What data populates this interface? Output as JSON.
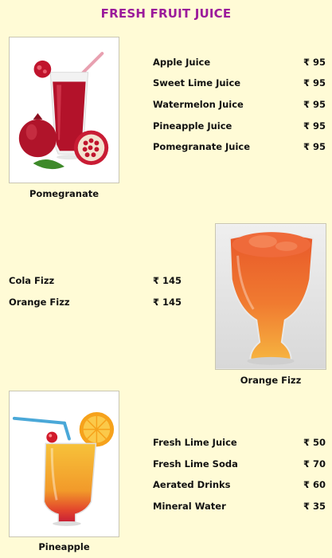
{
  "title": "FRESH FRUIT JUICE",
  "sections": [
    {
      "caption": "Pomegranate",
      "image_icon": "pomegranate-juice-photo",
      "items": [
        {
          "name": "Apple Juice",
          "price": "₹ 95"
        },
        {
          "name": "Sweet Lime Juice",
          "price": "₹ 95"
        },
        {
          "name": "Watermelon Juice",
          "price": "₹ 95"
        },
        {
          "name": "Pineapple Juice",
          "price": "₹ 95"
        },
        {
          "name": "Pomegranate Juice",
          "price": "₹ 95"
        }
      ]
    },
    {
      "caption": "Orange Fizz",
      "image_icon": "orange-fizz-photo",
      "items": [
        {
          "name": "Cola Fizz",
          "price": "₹ 145"
        },
        {
          "name": "Orange Fizz",
          "price": "₹ 145"
        }
      ]
    },
    {
      "caption": "Pineapple",
      "image_icon": "pineapple-juice-photo",
      "items": [
        {
          "name": "Fresh Lime Juice",
          "price": "₹ 50"
        },
        {
          "name": "Fresh Lime Soda",
          "price": "₹ 70"
        },
        {
          "name": "Aerated Drinks",
          "price": "₹ 60"
        },
        {
          "name": "Mineral Water",
          "price": "₹ 35"
        }
      ]
    }
  ],
  "colors": {
    "background": "#fffbd6",
    "title": "#9b1a9b",
    "text": "#111111"
  }
}
